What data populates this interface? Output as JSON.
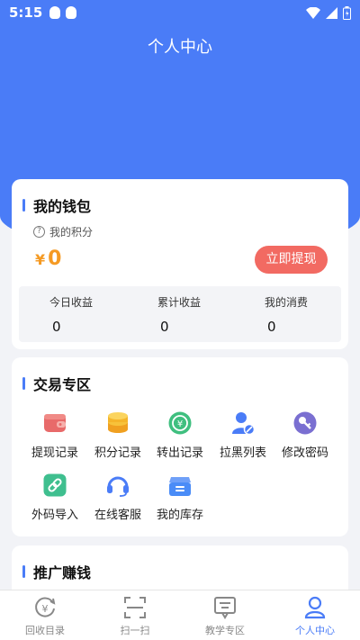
{
  "status_bar": {
    "time": "5:15"
  },
  "header": {
    "title": "个人中心"
  },
  "wallet": {
    "title": "我的钱包",
    "points_label": "我的积分",
    "currency": "¥",
    "points_value": "0",
    "withdraw_button": "立即提现",
    "stats": [
      {
        "label": "今日收益",
        "value": "0"
      },
      {
        "label": "累计收益",
        "value": "0"
      },
      {
        "label": "我的消费",
        "value": "0"
      }
    ]
  },
  "trade": {
    "title": "交易专区",
    "items": [
      {
        "label": "提现记录",
        "icon": "wallet-icon",
        "color": "#e86a6a"
      },
      {
        "label": "积分记录",
        "icon": "coins-icon",
        "color": "#f5b52a"
      },
      {
        "label": "转出记录",
        "icon": "transfer-yen-icon",
        "color": "#3fbf7f"
      },
      {
        "label": "拉黑列表",
        "icon": "block-user-icon",
        "color": "#4a7cf7"
      },
      {
        "label": "修改密码",
        "icon": "key-icon",
        "color": "#7a6fd1"
      },
      {
        "label": "外码导入",
        "icon": "link-import-icon",
        "color": "#3fbf8f"
      },
      {
        "label": "在线客服",
        "icon": "headset-icon",
        "color": "#4a7cf7"
      },
      {
        "label": "我的库存",
        "icon": "inventory-box-icon",
        "color": "#4a8cf7"
      }
    ]
  },
  "promo": {
    "title": "推广赚钱"
  },
  "tabbar": {
    "items": [
      {
        "label": "回收目录",
        "icon": "recycle-yen-icon",
        "active": false
      },
      {
        "label": "扫一扫",
        "icon": "scan-icon",
        "active": false
      },
      {
        "label": "教学专区",
        "icon": "teaching-icon",
        "active": false
      },
      {
        "label": "个人中心",
        "icon": "profile-icon",
        "active": true
      }
    ],
    "active_color": "#4a7cf7",
    "inactive_color": "#888888"
  }
}
